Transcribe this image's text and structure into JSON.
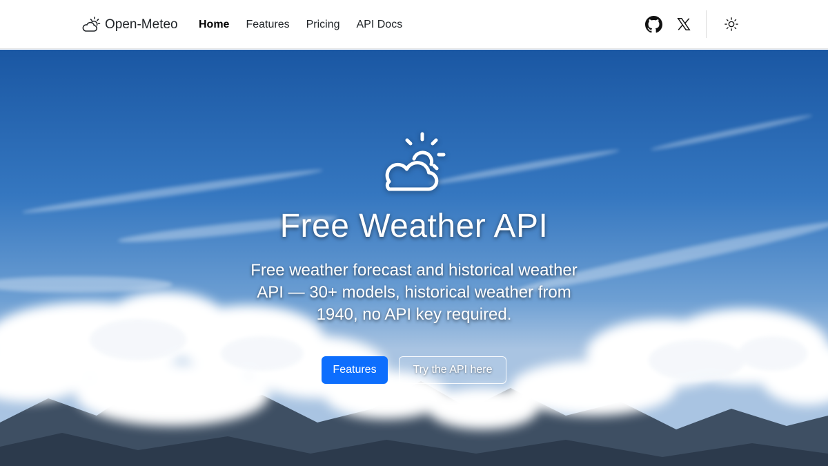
{
  "navbar": {
    "brand": {
      "name": "Open-Meteo",
      "icon": "cloud-sun-icon"
    },
    "links": [
      {
        "label": "Home",
        "active": true
      },
      {
        "label": "Features",
        "active": false
      },
      {
        "label": "Pricing",
        "active": false
      },
      {
        "label": "API Docs",
        "active": false
      }
    ],
    "icons": [
      "github-icon",
      "x-twitter-icon",
      "theme-toggle-sun-icon"
    ]
  },
  "hero": {
    "icon": "cloud-sun-icon",
    "title": "Free Weather API",
    "subtitle": "Free weather forecast and historical weather API — 30+ models, historical weather from 1940, no API key required.",
    "buttons": {
      "primary": "Features",
      "secondary": "Try the API here"
    }
  },
  "colors": {
    "primary": "#0d6efd",
    "sky": "#1d5aa6",
    "text": "#212529"
  }
}
